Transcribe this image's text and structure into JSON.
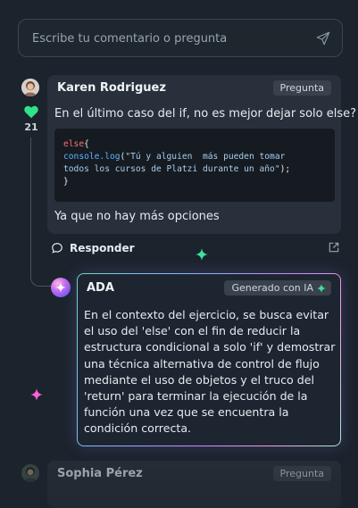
{
  "search": {
    "placeholder": "Escribe tu comentario o pregunta"
  },
  "comment": {
    "author": "Karen Rodriguez",
    "badge": "Pregunta",
    "likes": "21",
    "question": "En el último caso del if, no es mejor dejar solo else?",
    "code": {
      "keyword": "else",
      "brace_open": "{",
      "fn": "console.log",
      "paren_open": "(",
      "string": "\"Tú y alguien  más pueden tomar\ntodos los cursos de Platzi durante un año\"",
      "end": ");",
      "brace_close": "}"
    },
    "follow_up": "Ya que no hay más opciones",
    "reply_label": "Responder"
  },
  "ai_answer": {
    "name": "ADA",
    "badge": "Generado con IA",
    "text": "En el contexto del ejercicio, se busca evitar el uso del 'else' con el fin de reducir la estructura condicional a solo 'if' y demostrar una técnica alternativa de control de flujo mediante el uso de objetos y el truco del 'return' para terminar la ejecución de la función una vez que se encuentra la condición correcta."
  },
  "next_comment": {
    "author": "Sophia Pérez",
    "badge": "Pregunta"
  },
  "colors": {
    "background": "#1b232c",
    "card": "#28313b",
    "heart": "#2fe38a",
    "sparkle": "#3fe0a0",
    "sparkle_pink": "#ff5fd7",
    "code_keyword": "#ff6e70",
    "code_function": "#5fb3ff"
  },
  "icons": [
    "send-icon",
    "heart-icon",
    "reply-icon",
    "share-icon",
    "sparkle-icon"
  ]
}
